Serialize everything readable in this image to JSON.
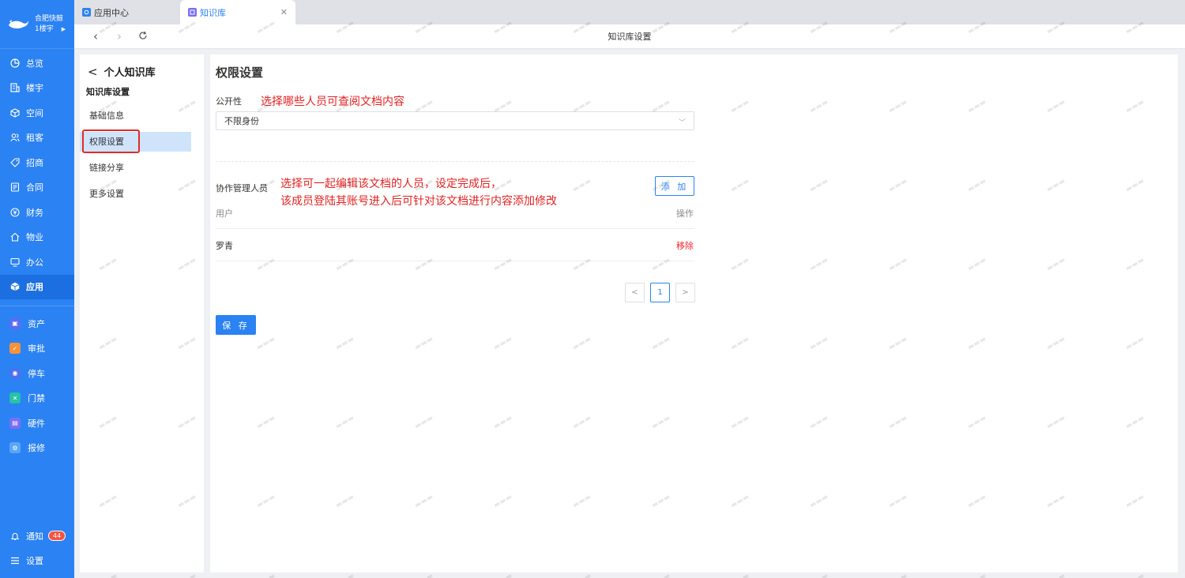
{
  "brand": {
    "name": "合肥快鲸",
    "sub": "1楼宇"
  },
  "sidebar": {
    "items": [
      {
        "label": "总览",
        "icon": "dashboard-icon"
      },
      {
        "label": "楼宇",
        "icon": "building-icon"
      },
      {
        "label": "空间",
        "icon": "cube-icon"
      },
      {
        "label": "租客",
        "icon": "users-icon"
      },
      {
        "label": "招商",
        "icon": "tag-icon"
      },
      {
        "label": "合同",
        "icon": "document-icon"
      },
      {
        "label": "财务",
        "icon": "currency-icon"
      },
      {
        "label": "物业",
        "icon": "home-icon"
      },
      {
        "label": "办公",
        "icon": "monitor-icon"
      },
      {
        "label": "应用",
        "icon": "app-cube-icon",
        "active": true
      }
    ],
    "apps": [
      {
        "label": "资产",
        "color": "#5b6cf5"
      },
      {
        "label": "审批",
        "color": "#f5933a"
      },
      {
        "label": "停车",
        "color": "#4a72f0"
      },
      {
        "label": "门禁",
        "color": "#25c2a5"
      },
      {
        "label": "硬件",
        "color": "#7b6ef6"
      },
      {
        "label": "报修",
        "color": "#58a6f8"
      }
    ],
    "notify_label": "通知",
    "notify_count": "44",
    "settings_label": "设置"
  },
  "tabs": [
    {
      "label": "应用中心",
      "active": false
    },
    {
      "label": "知识库",
      "active": true
    }
  ],
  "addressbar": {
    "title": "知识库设置"
  },
  "left_panel": {
    "back_title": "个人知识库",
    "section": "知识库设置",
    "items": [
      "基础信息",
      "权限设置",
      "链接分享",
      "更多设置"
    ],
    "active_index": 1
  },
  "main": {
    "title": "权限设置",
    "visibility_label": "公开性",
    "visibility_note": "选择哪些人员可查阅文档内容",
    "visibility_value": "不限身份",
    "collab_label": "协作管理人员",
    "collab_note_line1": "选择可一起编辑该文档的人员，设定完成后，",
    "collab_note_line2": "该成员登陆其账号进入后可针对该文档进行内容添加修改",
    "add_button": "添 加",
    "table": {
      "col_user": "用户",
      "col_action": "操作",
      "rows": [
        {
          "user": "罗青",
          "action": "移除"
        }
      ]
    },
    "pagination": {
      "current": "1"
    },
    "save_button": "保 存"
  },
  "colors": {
    "primary": "#2b82f3",
    "danger": "#f5222d",
    "annotation": "#e32222"
  }
}
